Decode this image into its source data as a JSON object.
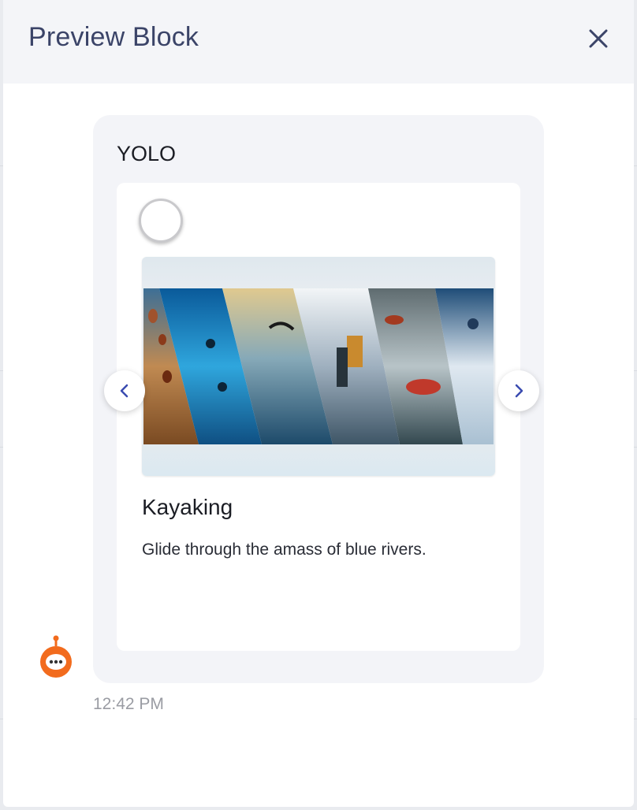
{
  "modal": {
    "title": "Preview Block"
  },
  "message": {
    "title": "YOLO",
    "card": {
      "heading": "Kayaking",
      "description": "Glide through the amass of blue rivers.",
      "image_alt": "Adventure sports collage"
    },
    "timestamp": "12:42 PM"
  },
  "icons": {
    "close": "close-icon",
    "prev": "chevron-left-icon",
    "next": "chevron-right-icon",
    "bot": "bot-avatar-icon"
  },
  "colors": {
    "title": "#3b4468",
    "accent": "#f26b1d",
    "arrow": "#3a4bb0",
    "bubble": "#f3f4f8"
  }
}
